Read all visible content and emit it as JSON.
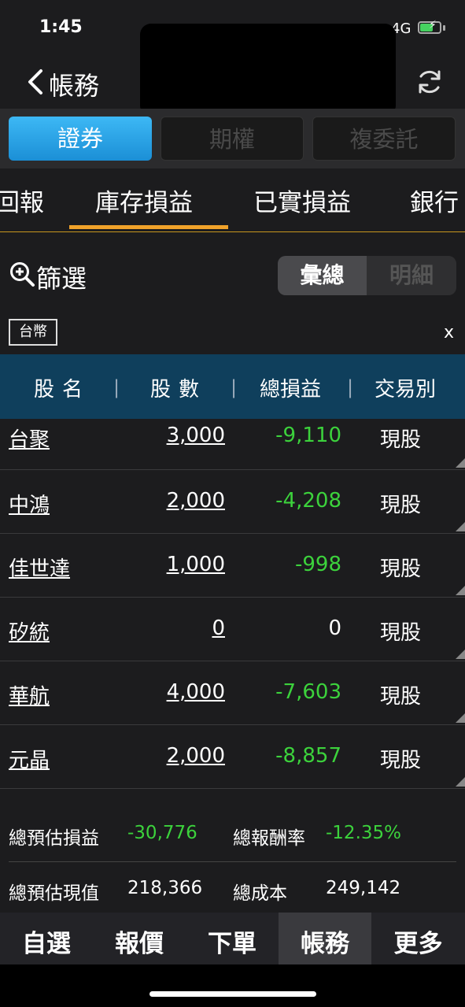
{
  "status_bar": {
    "time": "1:45",
    "network": "4G",
    "battery_color": "#46d160"
  },
  "nav": {
    "title": "帳務",
    "back_icon": "chevron-left-icon",
    "refresh_icon": "refresh-icon"
  },
  "segments": [
    {
      "label": "證券",
      "active": true
    },
    {
      "label": "期權",
      "active": false
    },
    {
      "label": "複委託",
      "active": false
    }
  ],
  "tabs": [
    {
      "label": "回報"
    },
    {
      "label": "庫存損益",
      "active": true
    },
    {
      "label": "已實損益"
    },
    {
      "label": "銀行"
    }
  ],
  "filter": {
    "label": "篩選",
    "icon": "zoom-in-icon",
    "toggle_on": "彙總",
    "toggle_off": "明細"
  },
  "currency": {
    "label": "台幣",
    "close": "x"
  },
  "table": {
    "headers": [
      "股名",
      "股數",
      "總損益",
      "交易別"
    ],
    "separator": "|",
    "rows": [
      {
        "name": "台聚",
        "qty": "3,000",
        "pl": "-9,110",
        "pl_color": "#3cd23c",
        "type": "現股"
      },
      {
        "name": "中鴻",
        "qty": "2,000",
        "pl": "-4,208",
        "pl_color": "#3cd23c",
        "type": "現股"
      },
      {
        "name": "佳世達",
        "qty": "1,000",
        "pl": "-998",
        "pl_color": "#3cd23c",
        "type": "現股"
      },
      {
        "name": "矽統",
        "qty": "0",
        "pl": "0",
        "pl_color": "#ffffff",
        "type": "現股"
      },
      {
        "name": "華航",
        "qty": "4,000",
        "pl": "-7,603",
        "pl_color": "#3cd23c",
        "type": "現股"
      },
      {
        "name": "元晶",
        "qty": "2,000",
        "pl": "-8,857",
        "pl_color": "#3cd23c",
        "type": "現股"
      }
    ]
  },
  "summary": {
    "est_pl_label": "總預估損益",
    "est_pl_value": "-30,776",
    "return_label": "總報酬率",
    "return_value": "-12.35%",
    "est_value_label": "總預估現值",
    "est_value_value": "218,366",
    "cost_label": "總成本",
    "cost_value": "249,142",
    "loss_color": "#3cd23c"
  },
  "bottom_tabs": [
    {
      "label": "自選"
    },
    {
      "label": "報價"
    },
    {
      "label": "下單"
    },
    {
      "label": "帳務",
      "active": true
    },
    {
      "label": "更多"
    }
  ]
}
